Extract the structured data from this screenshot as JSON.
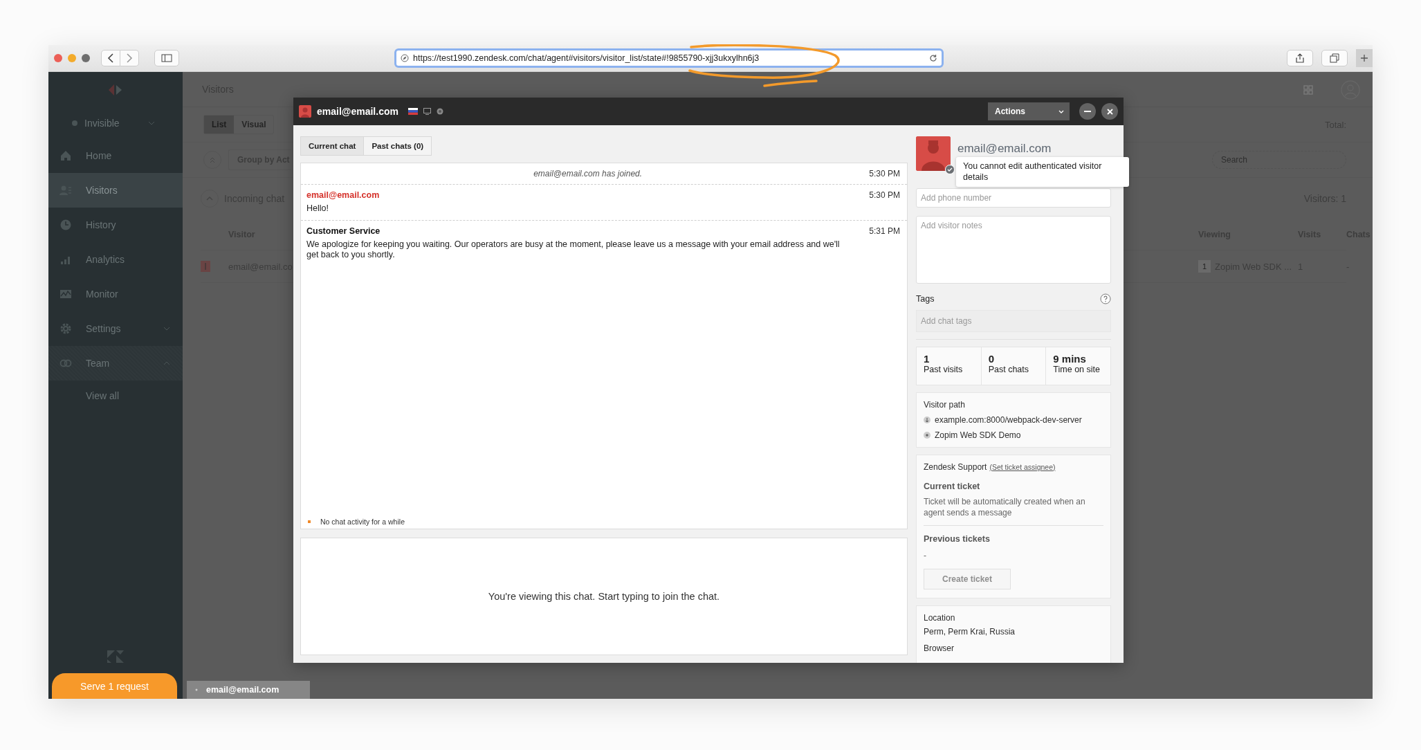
{
  "browser": {
    "url": "https://test1990.zendesk.com/chat/agent#visitors/visitor_list/state#!9855790-xjj3ukxylhn6j3"
  },
  "sidebar": {
    "status": "Invisible",
    "items": [
      {
        "kind": "link",
        "label": "Home",
        "selected": false
      },
      {
        "kind": "link",
        "label": "Visitors",
        "selected": true
      },
      {
        "kind": "link",
        "label": "History",
        "selected": false
      },
      {
        "kind": "link",
        "label": "Analytics",
        "selected": false
      },
      {
        "kind": "link",
        "label": "Monitor",
        "selected": false
      },
      {
        "kind": "group",
        "label": "Settings",
        "selected": false,
        "expanded": false
      },
      {
        "kind": "group",
        "label": "Team",
        "selected": false,
        "expanded": true,
        "children": [
          {
            "label": "View all",
            "selected": false
          }
        ]
      }
    ],
    "serve_button": "Serve 1 request"
  },
  "visitors_view": {
    "title": "Visitors",
    "view_tabs": [
      {
        "label": "List",
        "selected": true
      },
      {
        "label": "Visual",
        "selected": false
      }
    ],
    "total": "Total:",
    "group_by": "Group by Act",
    "search": {
      "placeholder": "Search"
    },
    "section": {
      "title": "Incoming chat",
      "expanded": true,
      "count": "Visitors: 1"
    },
    "columns": [
      "Visitor",
      "Viewing",
      "Visits",
      "Chats"
    ],
    "rows": [
      {
        "visitor": "email@email.co",
        "pages": "1",
        "viewing": "Zopim Web SDK ...",
        "visits": "1",
        "chats": "-"
      }
    ]
  },
  "chat_tab": "email@email.com",
  "chat_window": {
    "title": "email@email.com",
    "actions": "Actions",
    "tabs": [
      {
        "label": "Current chat",
        "selected": true
      },
      {
        "label": "Past chats (0)",
        "selected": false
      }
    ],
    "messages": [
      {
        "kind": "system",
        "text": "email@email.com has joined.",
        "time": "5:30 PM"
      },
      {
        "kind": "visitor",
        "sender": "email@email.com",
        "text": "Hello!",
        "time": "5:30 PM"
      },
      {
        "kind": "agent",
        "sender": "Customer Service",
        "text": "We apologize for keeping you waiting. Our operators are busy at the moment, please leave us a message with your email address and we'll get back to you shortly.",
        "time": "5:31 PM"
      }
    ],
    "activity_notice": "No chat activity for a while",
    "composer_notice": "You're viewing this chat. Start typing to join the chat."
  },
  "visitor": {
    "name": "email@email.com",
    "verified": true,
    "tooltip": "You cannot edit authenticated visitor details",
    "phone": {
      "placeholder": "Add phone number"
    },
    "notes": {
      "placeholder": "Add visitor notes"
    },
    "tags_label": "Tags",
    "tags": {
      "placeholder": "Add chat tags"
    },
    "stats": [
      {
        "value": "1",
        "label": "Past visits"
      },
      {
        "value": "0",
        "label": "Past chats"
      },
      {
        "value": "9 mins",
        "label": "Time on site"
      }
    ],
    "visitor_path": {
      "title": "Visitor path",
      "pages": [
        {
          "kind": "landing",
          "text": "example.com:8000/webpack-dev-server"
        },
        {
          "kind": "current",
          "text": "Zopim Web SDK Demo"
        }
      ]
    },
    "zendesk": {
      "title": "Zendesk Support",
      "link": "(Set ticket assignee)",
      "current_title": "Current ticket",
      "current_text": "Ticket will be automatically created when an agent sends a message",
      "previous_title": "Previous tickets",
      "previous_value": "-",
      "create_button": {
        "label": "Create ticket",
        "disabled": true
      }
    },
    "location": {
      "title": "Location",
      "value": "Perm, Perm Krai, Russia",
      "browser_title": "Browser"
    }
  }
}
